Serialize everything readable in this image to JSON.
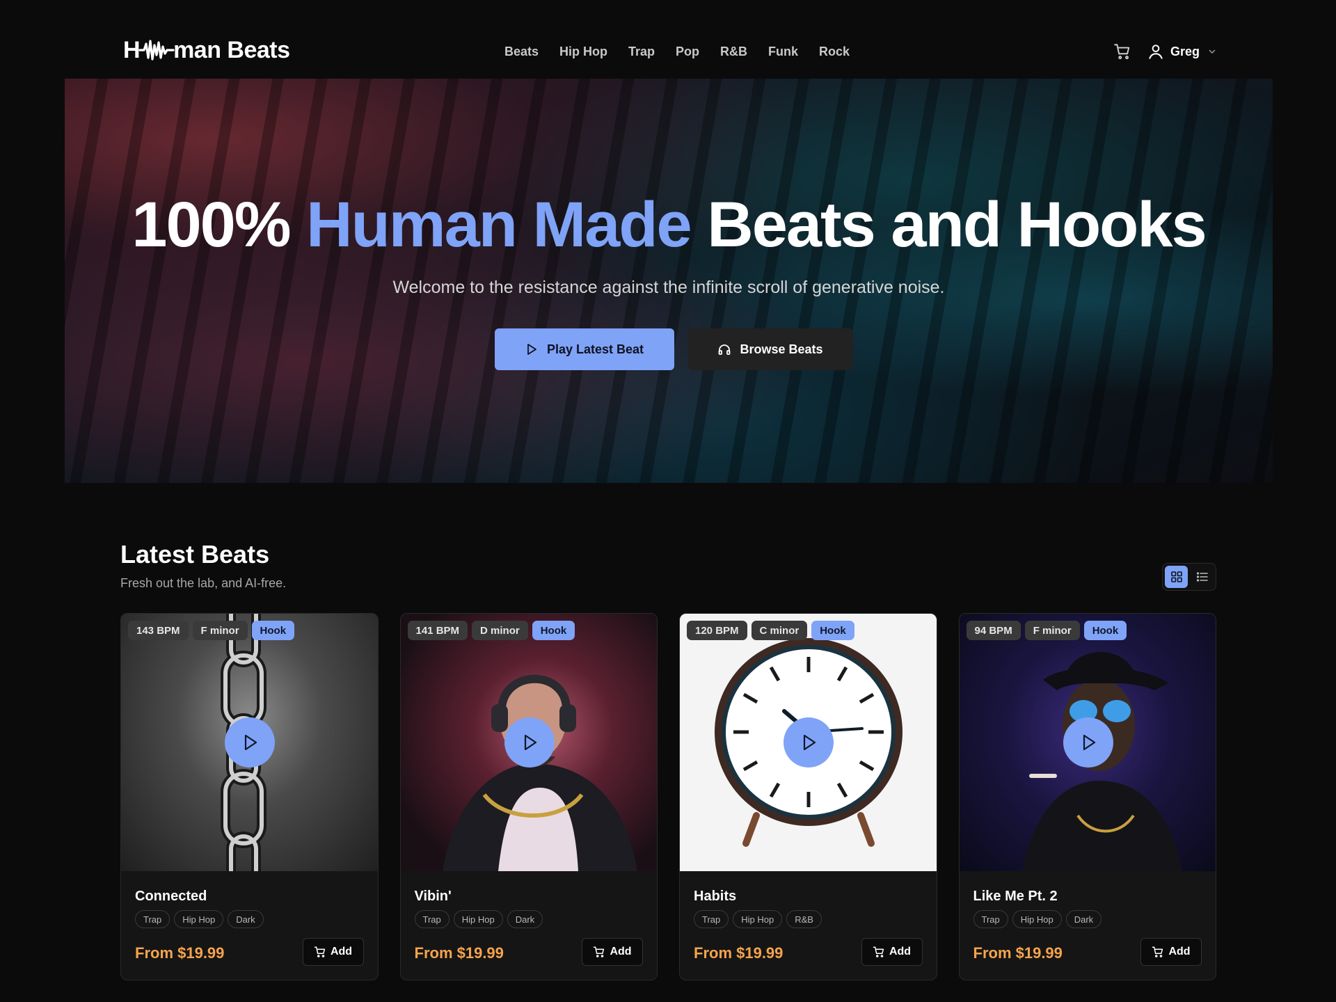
{
  "brand": {
    "logo_prefix": "H",
    "logo_suffix": "man Beats",
    "logo_icon": "waveform-icon",
    "accent_color": "#7fa3f7",
    "price_color": "#f6a44c"
  },
  "nav": {
    "items": [
      {
        "label": "Beats"
      },
      {
        "label": "Hip Hop"
      },
      {
        "label": "Trap"
      },
      {
        "label": "Pop"
      },
      {
        "label": "R&B"
      },
      {
        "label": "Funk"
      },
      {
        "label": "Rock"
      }
    ]
  },
  "header": {
    "cart_icon": "cart-icon",
    "user_icon": "user-icon",
    "user_name": "Greg"
  },
  "hero": {
    "title_lead": "100%",
    "title_accent": "Human Made",
    "title_trail": "Beats and Hooks",
    "subtitle": "Welcome to the resistance against the infinite scroll of generative noise.",
    "primary_button": "Play Latest Beat",
    "secondary_button": "Browse Beats"
  },
  "latest": {
    "title": "Latest Beats",
    "subtitle": "Fresh out the lab, and AI-free.",
    "view_modes": [
      "grid-icon",
      "list-icon"
    ],
    "active_view": "grid",
    "cards": [
      {
        "bpm": "143 BPM",
        "key": "F minor",
        "hook": "Hook",
        "title": "Connected",
        "tags": [
          "Trap",
          "Hip Hop",
          "Dark"
        ],
        "price": "From $19.99",
        "add": "Add"
      },
      {
        "bpm": "141 BPM",
        "key": "D minor",
        "hook": "Hook",
        "title": "Vibin'",
        "tags": [
          "Trap",
          "Hip Hop",
          "Dark"
        ],
        "price": "From $19.99",
        "add": "Add"
      },
      {
        "bpm": "120 BPM",
        "key": "C minor",
        "hook": "Hook",
        "title": "Habits",
        "tags": [
          "Trap",
          "Hip Hop",
          "R&B"
        ],
        "price": "From $19.99",
        "add": "Add"
      },
      {
        "bpm": "94 BPM",
        "key": "F minor",
        "hook": "Hook",
        "title": "Like Me Pt. 2",
        "tags": [
          "Trap",
          "Hip Hop",
          "Dark"
        ],
        "price": "From $19.99",
        "add": "Add"
      }
    ]
  }
}
